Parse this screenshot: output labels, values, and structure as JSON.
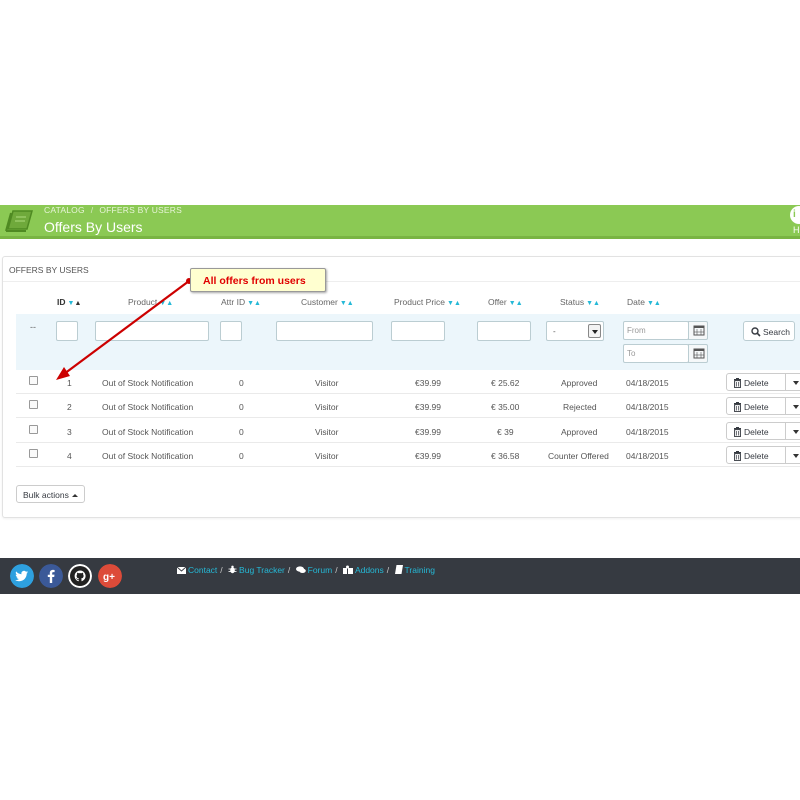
{
  "header": {
    "breadcrumb": [
      "CATALOG",
      "OFFERS BY USERS"
    ],
    "breadcrumb_sep": "/",
    "title": "Offers By Users",
    "help_label": "H",
    "accent_color": "#8bc954"
  },
  "panel": {
    "heading": "OFFERS BY USERS"
  },
  "columns": {
    "id": "ID",
    "product": "Product",
    "attr_id": "Attr ID",
    "customer": "Customer",
    "product_price": "Product Price",
    "offer": "Offer",
    "status": "Status",
    "date": "Date"
  },
  "filters": {
    "dash": "--",
    "status_selected": "-",
    "date_from_placeholder": "From",
    "date_to_placeholder": "To",
    "search_label": "Search"
  },
  "rows": [
    {
      "id": "1",
      "product": "Out of Stock Notification",
      "attr_id": "0",
      "customer": "Visitor",
      "product_price": "€39.99",
      "offer": "€ 25.62",
      "status": "Approved",
      "date": "04/18/2015",
      "action": "Delete"
    },
    {
      "id": "2",
      "product": "Out of Stock Notification",
      "attr_id": "0",
      "customer": "Visitor",
      "product_price": "€39.99",
      "offer": "€ 35.00",
      "status": "Rejected",
      "date": "04/18/2015",
      "action": "Delete"
    },
    {
      "id": "3",
      "product": "Out of Stock Notification",
      "attr_id": "0",
      "customer": "Visitor",
      "product_price": "€39.99",
      "offer": "€ 39",
      "status": "Approved",
      "date": "04/18/2015",
      "action": "Delete"
    },
    {
      "id": "4",
      "product": "Out of Stock Notification",
      "attr_id": "0",
      "customer": "Visitor",
      "product_price": "€39.99",
      "offer": "€ 36.58",
      "status": "Counter Offered",
      "date": "04/18/2015",
      "action": "Delete"
    }
  ],
  "bulk_actions_label": "Bulk actions",
  "callout_text": "All offers from users",
  "footer": {
    "social_icons": [
      "twitter-icon",
      "facebook-icon",
      "github-icon",
      "google-plus-icon"
    ],
    "links": {
      "contact": "Contact",
      "bug_tracker": "Bug Tracker",
      "forum": "Forum",
      "addons": "Addons",
      "training": "Training"
    },
    "sep": "/"
  }
}
